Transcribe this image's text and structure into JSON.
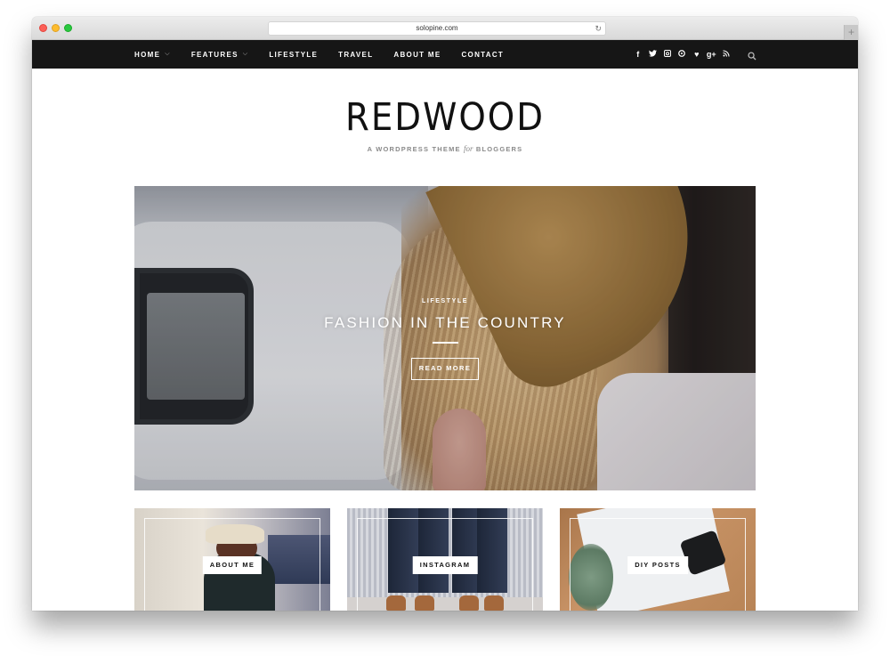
{
  "browser": {
    "url": "solopine.com",
    "reload_icon": "reload-icon",
    "new_tab_icon": "plus-icon"
  },
  "nav": {
    "items": [
      {
        "label": "HOME",
        "has_dropdown": true
      },
      {
        "label": "FEATURES",
        "has_dropdown": true
      },
      {
        "label": "LIFESTYLE",
        "has_dropdown": false
      },
      {
        "label": "TRAVEL",
        "has_dropdown": false
      },
      {
        "label": "ABOUT ME",
        "has_dropdown": false
      },
      {
        "label": "CONTACT",
        "has_dropdown": false
      }
    ],
    "dropdown_glyph": "⌵",
    "social": [
      {
        "name": "facebook-icon",
        "glyph": "f"
      },
      {
        "name": "twitter-icon",
        "glyph": "🐦"
      },
      {
        "name": "instagram-icon",
        "glyph": "◘"
      },
      {
        "name": "pinterest-icon",
        "glyph": "◉"
      },
      {
        "name": "heart-icon",
        "glyph": "♥"
      },
      {
        "name": "google-plus-icon",
        "glyph": "g+"
      },
      {
        "name": "rss-icon",
        "glyph": "◣"
      }
    ],
    "search_icon": "search-icon"
  },
  "header": {
    "logo": "REDWOOD",
    "tagline_pre": "A WORDPRESS THEME",
    "tagline_italic": "for",
    "tagline_post": "BLOGGERS"
  },
  "hero": {
    "category": "LIFESTYLE",
    "title": "FASHION IN THE COUNTRY",
    "button": "READ MORE"
  },
  "cards": [
    {
      "label": "ABOUT ME"
    },
    {
      "label": "INSTAGRAM"
    },
    {
      "label": "DIY POSTS"
    }
  ],
  "colors": {
    "nav_bg": "#161616",
    "nav_text": "#ffffff",
    "logo_text": "#111111",
    "tagline_text": "#8a8a8a"
  }
}
